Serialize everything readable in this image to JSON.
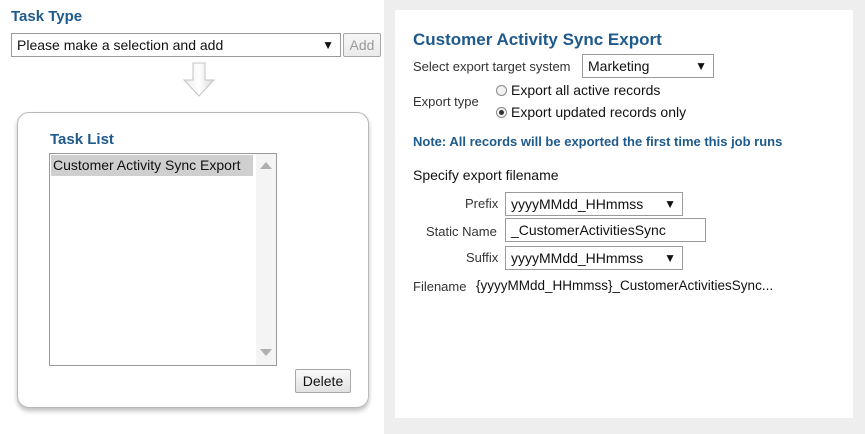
{
  "task_type": {
    "title": "Task Type",
    "select_value": "Please make a selection and add",
    "add_label": "Add"
  },
  "task_list": {
    "title": "Task List",
    "items": [
      "Customer Activity Sync Export"
    ],
    "delete_label": "Delete"
  },
  "export": {
    "title": "Customer Activity Sync Export",
    "target_label": "Select export target system",
    "target_value": "Marketing",
    "type_label": "Export type",
    "option_all": "Export all active records",
    "option_updated": "Export updated records only",
    "selected_option": "updated",
    "note": "Note: All records will be exported the first time this job runs",
    "filename_heading": "Specify export filename",
    "prefix_label": "Prefix",
    "prefix_value": "yyyyMMdd_HHmmss",
    "static_label": "Static Name",
    "static_value": "_CustomerActivitiesSync",
    "suffix_label": "Suffix",
    "suffix_value": "yyyyMMdd_HHmmss",
    "filename_label": "Filename",
    "filename_value": "{yyyyMMdd_HHmmss}_CustomerActivitiesSync..."
  },
  "icons": {
    "dropdown": "dropdown-caret-icon",
    "arrow": "down-arrow-icon"
  },
  "colors": {
    "heading": "#1f5a8c",
    "panel_bg": "#eeeeee"
  }
}
